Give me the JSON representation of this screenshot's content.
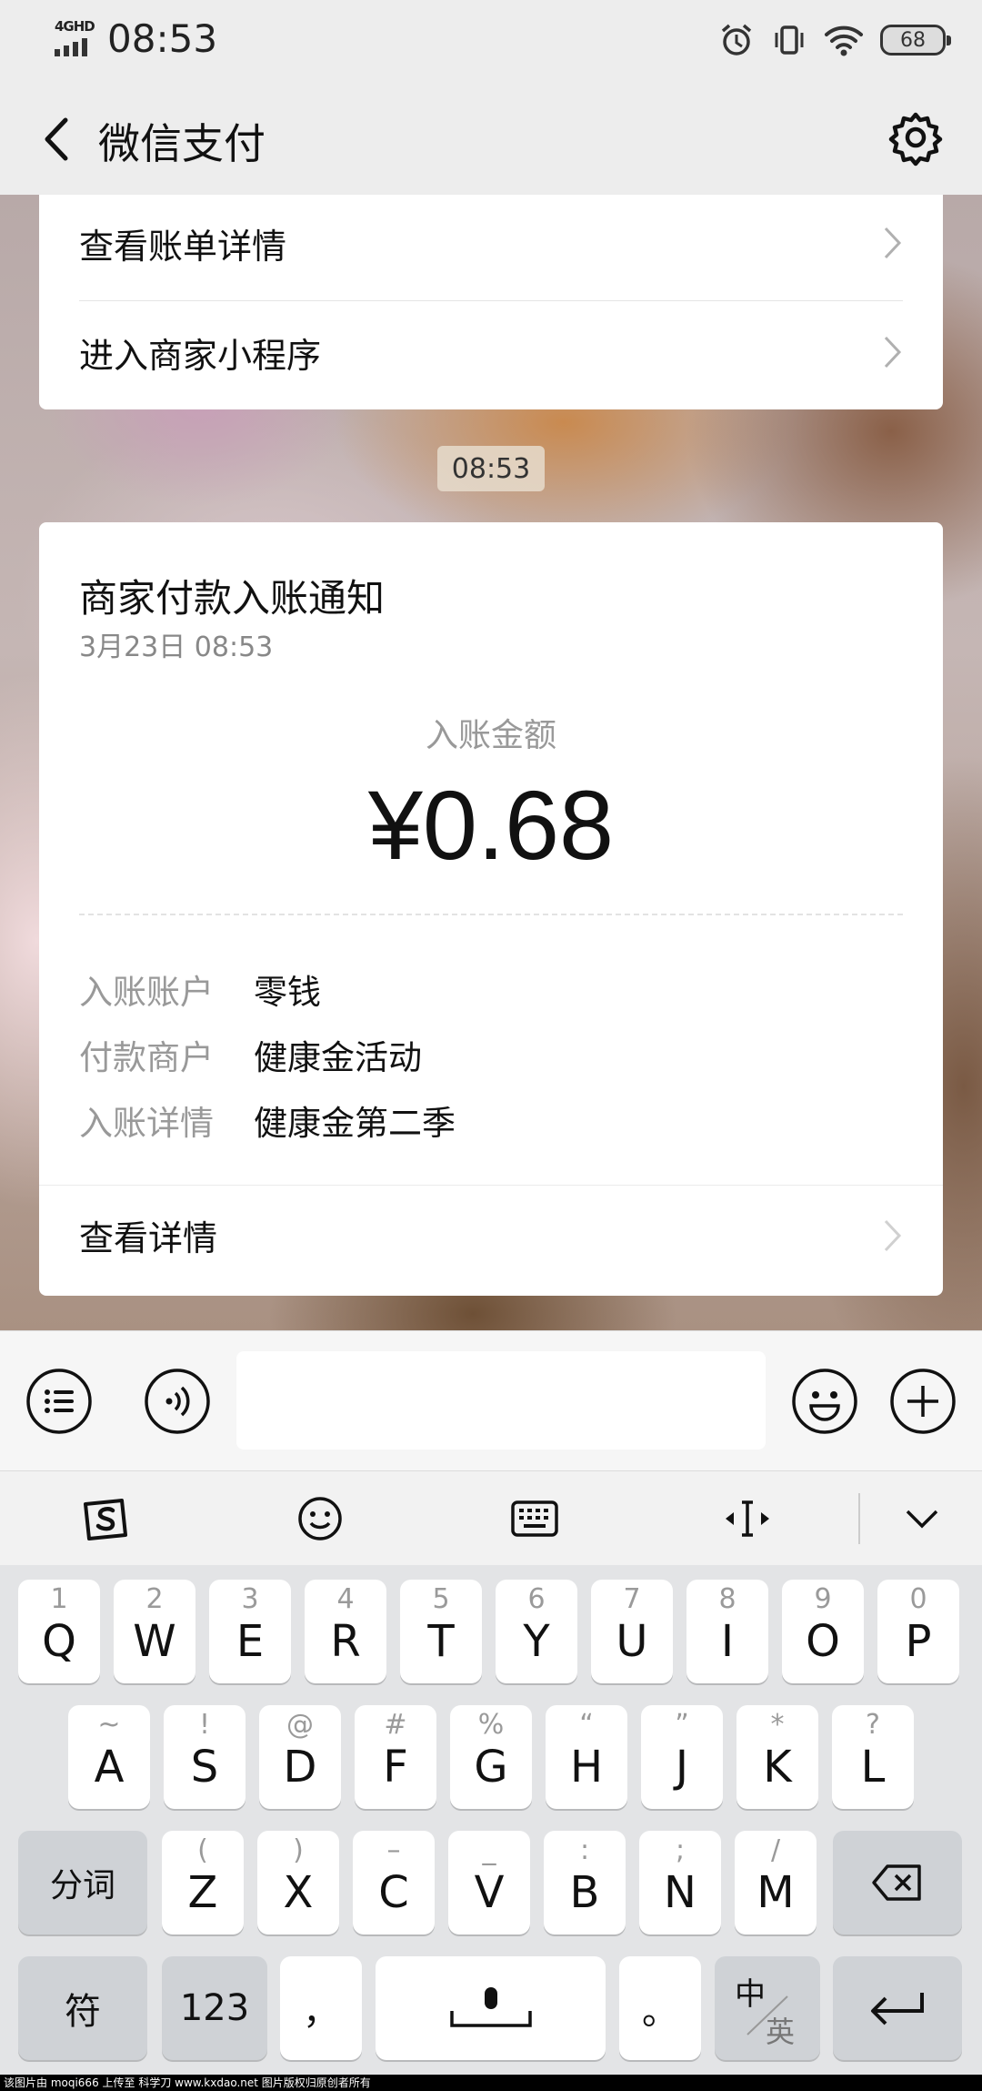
{
  "status": {
    "network": "4GHD",
    "time": "08:53",
    "battery": "68"
  },
  "nav": {
    "title": "微信支付"
  },
  "card1": {
    "view_bill": "查看账单详情",
    "merchant_mini": "进入商家小程序"
  },
  "chat_time": "08:53",
  "notice": {
    "title": "商家付款入账通知",
    "date": "3月23日  08:53",
    "amount_label": "入账金额",
    "amount": "¥0.68",
    "rows": [
      {
        "k": "入账账户",
        "v": "零钱"
      },
      {
        "k": "付款商户",
        "v": "健康金活动"
      },
      {
        "k": "入账详情",
        "v": "健康金第二季"
      }
    ],
    "view_details": "查看详情"
  },
  "input": {
    "placeholder": ""
  },
  "keyboard": {
    "row1": [
      {
        "n": "1",
        "k": "Q"
      },
      {
        "n": "2",
        "k": "W"
      },
      {
        "n": "3",
        "k": "E"
      },
      {
        "n": "4",
        "k": "R"
      },
      {
        "n": "5",
        "k": "T"
      },
      {
        "n": "6",
        "k": "Y"
      },
      {
        "n": "7",
        "k": "U"
      },
      {
        "n": "8",
        "k": "I"
      },
      {
        "n": "9",
        "k": "O"
      },
      {
        "n": "0",
        "k": "P"
      }
    ],
    "row2": [
      {
        "n": "~",
        "k": "A"
      },
      {
        "n": "!",
        "k": "S"
      },
      {
        "n": "@",
        "k": "D"
      },
      {
        "n": "#",
        "k": "F"
      },
      {
        "n": "%",
        "k": "G"
      },
      {
        "n": "“",
        "k": "H"
      },
      {
        "n": "”",
        "k": "J"
      },
      {
        "n": "*",
        "k": "K"
      },
      {
        "n": "?",
        "k": "L"
      }
    ],
    "row3": [
      {
        "n": "(",
        "k": "Z"
      },
      {
        "n": ")",
        "k": "X"
      },
      {
        "n": "–",
        "k": "C"
      },
      {
        "n": "_",
        "k": "V"
      },
      {
        "n": ":",
        "k": "B"
      },
      {
        "n": ";",
        "k": "N"
      },
      {
        "n": "/",
        "k": "M"
      }
    ],
    "fenci": "分词",
    "fu": "符",
    "num": "123",
    "comma": "，",
    "period": "。",
    "zh": "中",
    "en": "英"
  },
  "footer": "该图片由 moqi666 上传至 科学刀 www.kxdao.net 图片版权归原创者所有"
}
